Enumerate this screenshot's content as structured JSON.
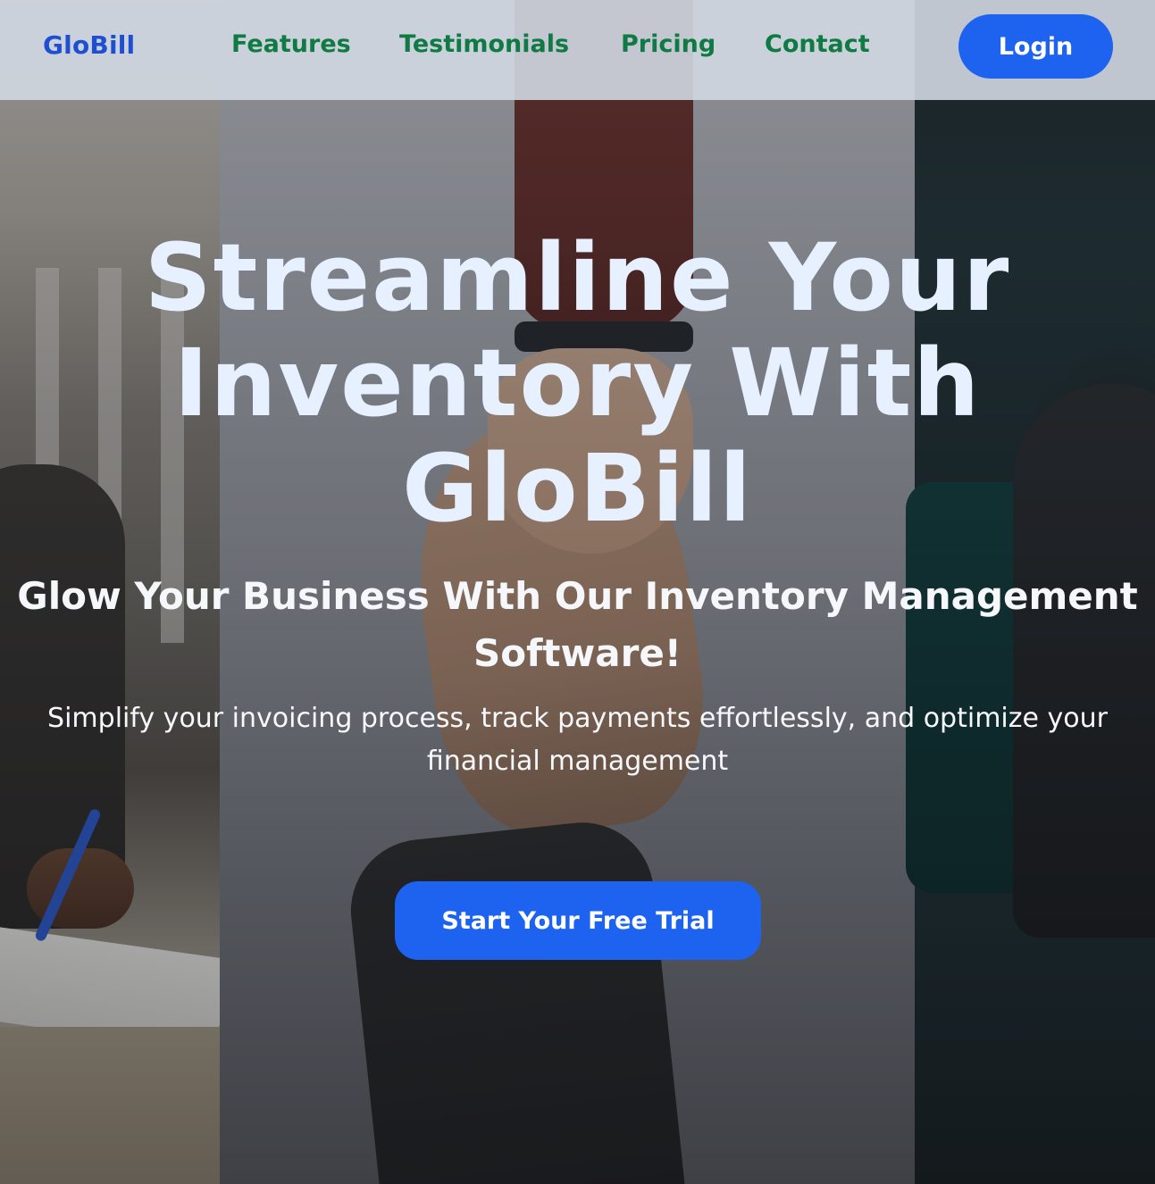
{
  "nav": {
    "logo": "GloBill",
    "links": [
      "Features",
      "Testimonials",
      "Pricing",
      "Contact"
    ],
    "login_label": "Login"
  },
  "hero": {
    "headline_lines": [
      "Streamline Your",
      "Inventory With",
      "GloBill"
    ],
    "subheadline_lines": [
      "Glow Your Business With Our Inventory Management",
      "Software!"
    ],
    "description_lines": [
      "Simplify your invoicing process, track payments effortlessly, and optimize your",
      "financial management"
    ],
    "cta_label": "Start Your Free Trial"
  },
  "colors": {
    "brand_blue": "#1d63f0",
    "logo_blue": "#1f4fd1",
    "nav_link_green": "#0f7a43",
    "headline_text": "#e6f0ff"
  }
}
